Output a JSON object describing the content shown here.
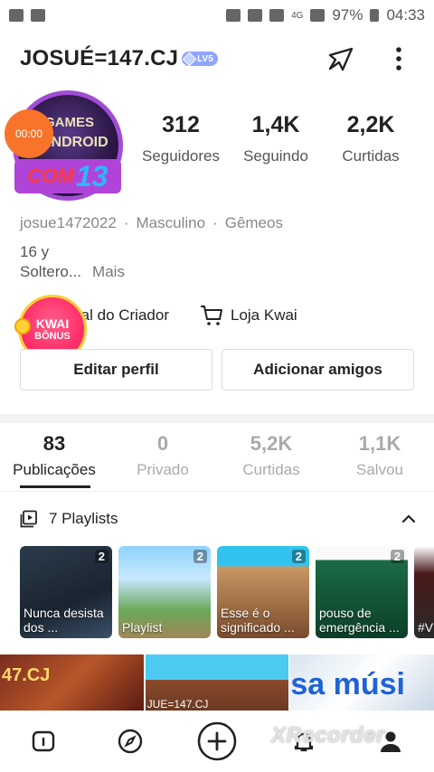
{
  "status_bar": {
    "battery": "97%",
    "time": "04:33",
    "network": "4G"
  },
  "header": {
    "username": "JOSUÉ=147.CJ",
    "level_badge": "LV5"
  },
  "avatar": {
    "line1": "GAMES",
    "line2": "ANDROID",
    "tag_prefix": "COM",
    "tag_number": "13"
  },
  "timer": "00:00",
  "stats": [
    {
      "value": "312",
      "label": "Seguidores"
    },
    {
      "value": "1,4K",
      "label": "Seguindo"
    },
    {
      "value": "2,2K",
      "label": "Curtidas"
    }
  ],
  "bio": {
    "handle": "josue1472022",
    "sep": "·",
    "gender": "Masculino",
    "sign": "Gêmeos",
    "age": "16 y",
    "relationship": "Soltero...",
    "more": "Mais"
  },
  "creator": {
    "panel_label": "ral do Criador",
    "shop_label": "Loja Kwai"
  },
  "kwai_bonus": {
    "line1": "KWAI",
    "line2": "BÔNUS"
  },
  "buttons": {
    "edit": "Editar perfil",
    "add_friends": "Adicionar amigos"
  },
  "tabs": [
    {
      "value": "83",
      "label": "Publicações"
    },
    {
      "value": "0",
      "label": "Privado"
    },
    {
      "value": "5,2K",
      "label": "Curtidas"
    },
    {
      "value": "1,1K",
      "label": "Salvou"
    }
  ],
  "playlists_header": "7 Playlists",
  "playlists": [
    {
      "badge": "2",
      "caption": "Nunca desista dos ..."
    },
    {
      "badge": "2",
      "caption": "Playlist"
    },
    {
      "badge": "2",
      "caption": "Esse é o significado ..."
    },
    {
      "badge": "2",
      "caption": "pouso de emergência ..."
    },
    {
      "badge": "",
      "caption": "#V ar"
    }
  ],
  "thumbs": [
    {
      "text": "47.CJ"
    },
    {
      "text": "JUE=147.CJ"
    },
    {
      "text": "sa músi"
    }
  ],
  "watermark": "XRecorder"
}
